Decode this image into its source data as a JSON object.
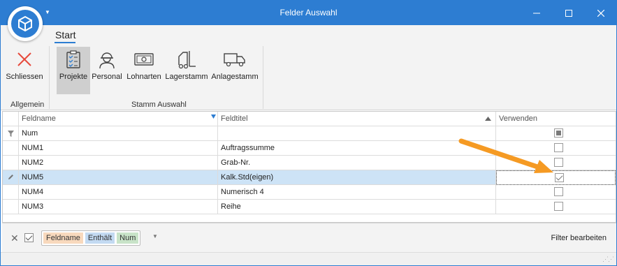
{
  "window": {
    "title": "Felder Auswahl",
    "minimize_glyph": "—",
    "maximize_glyph": "☐",
    "close_glyph": "✕"
  },
  "ribbon": {
    "tab": "Start",
    "groups": [
      {
        "label": "Allgemein",
        "buttons": [
          {
            "label": "Schliessen",
            "icon": "close-x-icon"
          }
        ]
      },
      {
        "label": "Stamm Auswahl",
        "buttons": [
          {
            "label": "Projekte",
            "icon": "clipboard-checklist-icon",
            "active": true
          },
          {
            "label": "Personal",
            "icon": "worker-helmet-icon"
          },
          {
            "label": "Lohnarten",
            "icon": "banknote-icon"
          },
          {
            "label": "Lagerstamm",
            "icon": "forklift-icon"
          },
          {
            "label": "Anlagestamm",
            "icon": "truck-icon"
          }
        ]
      }
    ]
  },
  "grid": {
    "columns": {
      "name": "Feldname",
      "title": "Feldtitel",
      "use": "Verwenden"
    },
    "filter_row": {
      "name": "Num",
      "title": "",
      "use": "indeterminate"
    },
    "rows": [
      {
        "name": "NUM1",
        "title": "Auftragssumme",
        "checked": false
      },
      {
        "name": "NUM2",
        "title": "Grab-Nr.",
        "checked": false
      },
      {
        "name": "NUM5",
        "title": "Kalk.Std(eigen)",
        "checked": true,
        "selected": true
      },
      {
        "name": "NUM4",
        "title": "Numerisch 4",
        "checked": false
      },
      {
        "name": "NUM3",
        "title": "Reihe",
        "checked": false
      }
    ]
  },
  "filter_panel": {
    "clear_glyph": "✕",
    "field": "Feldname",
    "operator": "Enthält",
    "value": "Num",
    "edit_label": "Filter bearbeiten"
  },
  "colors": {
    "accent": "#2d7dd2",
    "selection": "#cde3f6",
    "annotation_arrow": "#f59a23"
  }
}
